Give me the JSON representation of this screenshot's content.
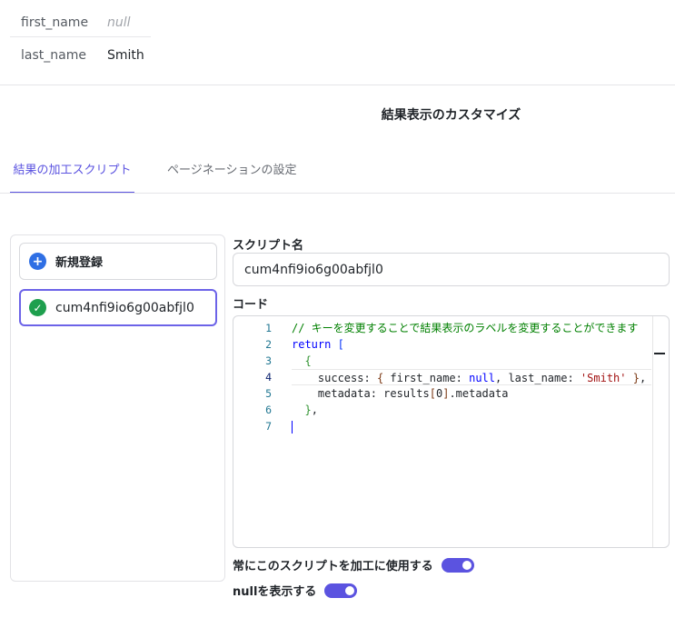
{
  "record": {
    "rows": [
      {
        "key": "first_name",
        "value": "null"
      },
      {
        "key": "last_name",
        "value": "Smith"
      }
    ]
  },
  "section": {
    "title": "結果表示のカスタマイズ"
  },
  "tabs": [
    {
      "label": "結果の加工スクリプト",
      "active": true
    },
    {
      "label": "ページネーションの設定",
      "active": false
    }
  ],
  "script_list": {
    "new_label": "新規登録",
    "new_icon": "plus-circle-icon",
    "items": [
      {
        "name": "cum4nfi9io6g00abfjl0",
        "icon": "check-circle-icon",
        "selected": true
      }
    ]
  },
  "form": {
    "name_label": "スクリプト名",
    "name_value": "cum4nfi9io6g00abfjl0",
    "code_label": "コード"
  },
  "editor": {
    "line_numbers": [
      "1",
      "2",
      "3",
      "4",
      "5",
      "6",
      "7"
    ],
    "active_line": 4,
    "lines": {
      "l1": "// キーを変更することで結果表示のラベルを変更することができます",
      "l2_kw": "return",
      "l2_br": "[",
      "l3_br": "{",
      "l4_a": "success: ",
      "l4_b": "{",
      "l4_c": " first_name: ",
      "l4_null": "null",
      "l4_d": ", last_name: ",
      "l4_str": "'Smith'",
      "l4_e": " ",
      "l4_f": "}",
      "l4_g": ",",
      "l5_a": "metadata: results",
      "l5_b": "[",
      "l5_c": "0",
      "l5_d": "]",
      "l5_e": ".metadata",
      "l6_br": "}",
      "l6_end": ","
    }
  },
  "toggles": {
    "always_use": {
      "label": "常にこのスクリプトを加工に使用する",
      "on": true
    },
    "show_null": {
      "label": "nullを表示する",
      "on": true
    }
  },
  "colors": {
    "accent": "#5b53e0",
    "new_icon": "#2f6fe4",
    "check_icon": "#1e9f4e"
  }
}
